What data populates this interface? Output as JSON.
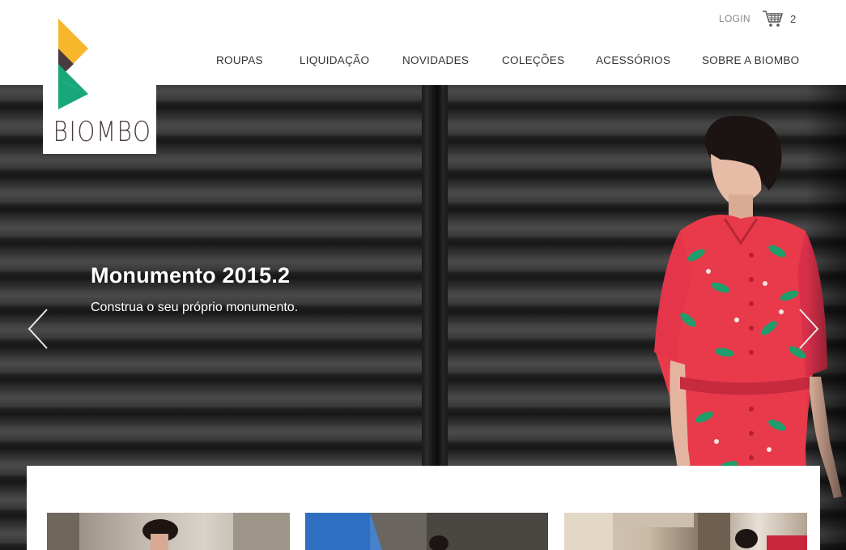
{
  "brand": {
    "name": "BIOMBO",
    "colors": {
      "yellow": "#f8b62d",
      "plum": "#4a3b3e",
      "green": "#17a77a"
    }
  },
  "header": {
    "login_label": "LOGIN",
    "cart": {
      "icon": "shopping-cart-icon",
      "count": "2"
    }
  },
  "nav": {
    "items": [
      {
        "label": "ROUPAS"
      },
      {
        "label": "LIQUIDAÇÃO"
      },
      {
        "label": "NOVIDADES"
      },
      {
        "label": "COLEÇÕES"
      },
      {
        "label": "ACESSÓRIOS"
      },
      {
        "label": "SOBRE A BIOMBO"
      }
    ]
  },
  "hero": {
    "title": "Monumento 2015.2",
    "subtitle": "Construa o seu próprio monumento.",
    "prev_icon": "chevron-left-icon",
    "next_icon": "chevron-right-icon"
  }
}
